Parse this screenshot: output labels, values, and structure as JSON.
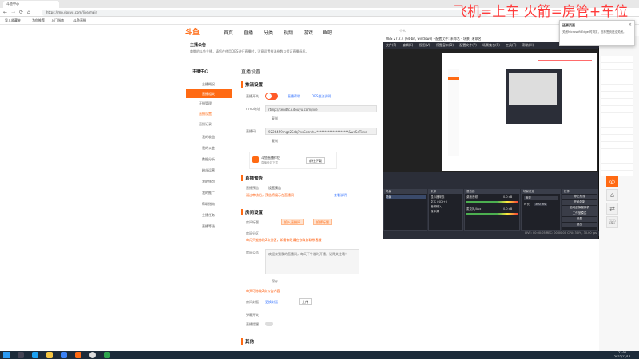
{
  "browser": {
    "tab_title": "斗鱼中心",
    "url": "https://mp.douyu.com/live/main",
    "bookmarks": [
      "导入收藏夹",
      "为你推荐",
      "入门指南",
      "斗鱼直播"
    ],
    "user_label": "个人"
  },
  "site": {
    "logo_text": "斗鱼",
    "nav": [
      "首页",
      "直播",
      "分类",
      "视频",
      "游戏",
      "鱼吧"
    ],
    "notice_title": "主播公告",
    "notice_text": "尊敬的斗鱼主播，请您在使用OBS进行直播时，注意设置推流参数以保证直播画质。"
  },
  "sidebar": {
    "header": "主播中心",
    "items": [
      {
        "label": "主播概况"
      },
      {
        "label": "直播相关",
        "active": true
      },
      {
        "label": "开播管理"
      },
      {
        "label": "直播设置"
      },
      {
        "label": "直播记录"
      },
      {
        "label": "我的收益"
      },
      {
        "label": "我的公会"
      },
      {
        "label": "数据分析"
      },
      {
        "label": "粉丝运营"
      },
      {
        "label": "我的钱包"
      },
      {
        "label": "我的推广"
      },
      {
        "label": "帮助指南"
      },
      {
        "label": "主播任务"
      },
      {
        "label": "直播等级"
      }
    ]
  },
  "main": {
    "page_title": "直播设置",
    "stream_section": "推流设置",
    "stream_switch_label": "直播开关",
    "stream_links": [
      "直播帮助",
      "OBS推流说明"
    ],
    "rtmp_label": "rtmp地址",
    "rtmp_value": "rtmp://sendtc3.douyu.com/live",
    "copy_label": "复制",
    "key_label": "直播码",
    "key_value": "9226459mgc2Sdq?wsSecret=********************&wsSeTime",
    "tool_title": "斗鱼直播伴侣",
    "tool_sub": "直播伴侣下载",
    "tool_btn": "前往下载",
    "notice_section": "直播预告",
    "notice_label": "直播预告",
    "notice_set": "设置预告",
    "notice_warn": "通过审核后，预告将展示在直播间",
    "notice_link": "查看说明",
    "room_section": "房间设置",
    "room_title_label": "房间标题",
    "room_btn1": "投入直播间",
    "room_btn2": "投掷标题",
    "room_label2": "房间分区",
    "room_warn": "每月只能修改2次分区，如需修改请在修改前联系客服",
    "room_desc_label": "房间公告",
    "room_desc_text": "欢迎来到我的直播间，每天下午准时开播，记得关注哦！",
    "save_label": "保存",
    "room_warn2": "每天可修改2次公告内容",
    "cover_label": "房间封面",
    "cover_link": "更换封面",
    "cover_btn": "上传",
    "switch_label2": "弹幕开关",
    "switch_label3": "直播提醒",
    "other_section": "其他"
  },
  "obs": {
    "title": "OBS 27.2.4 (64-bit, windows) - 配置文件: 未命名 - 场景: 未命名",
    "menu": [
      "文件(F)",
      "编辑(E)",
      "视图(V)",
      "停靠窗口(D)",
      "配置文件(P)",
      "场景集合(S)",
      "工具(T)",
      "帮助(H)"
    ],
    "scenes_header": "场景",
    "scene_item": "场景",
    "sources_header": "来源",
    "sources": [
      "显示器采集",
      "文本 (GDI+)",
      "音频输入",
      "媒体源"
    ],
    "mixer_header": "混音器",
    "mixer": [
      "桌面音频",
      "麦克风/Aux"
    ],
    "mixer_db": [
      "0.0 dB",
      "0.0 dB"
    ],
    "transition_header": "场景过渡",
    "transition_value": "渐变",
    "duration_label": "时长",
    "duration_value": "300 ms",
    "controls_header": "控件",
    "controls": [
      "停止推流",
      "开始录制",
      "启动虚拟摄像机",
      "工作室模式",
      "设置",
      "退出"
    ],
    "status": "LIVE: 00:00:05  REC: 00:00:00  CPU: 3.0%, 30.00 fps"
  },
  "popup": {
    "title": "还原页面",
    "text": "关闭Microsoft Edge 时浏览，但标签页还没关闭。"
  },
  "banner": "飞机=上车 火箭=房管+车位",
  "taskbar": {
    "time": "21:00",
    "date": "2022/12/17"
  }
}
